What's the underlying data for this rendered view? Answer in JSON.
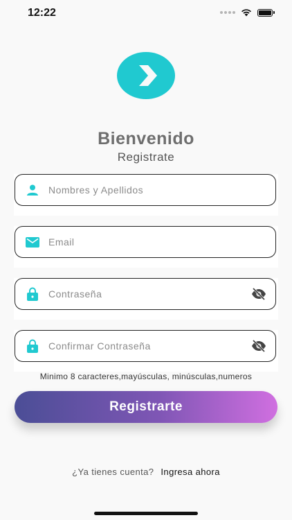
{
  "status_bar": {
    "time": "12:22"
  },
  "header": {
    "title": "Bienvenido",
    "subtitle": "Registrate"
  },
  "form": {
    "fields": [
      {
        "icon": "user-icon",
        "placeholder": "Nombres y Apellidos"
      },
      {
        "icon": "mail-icon",
        "placeholder": "Email"
      },
      {
        "icon": "lock-icon",
        "placeholder": "Contraseña",
        "trailing_icon": "eye-off-icon"
      },
      {
        "icon": "lock-icon",
        "placeholder": "Confirmar Contraseña",
        "trailing_icon": "eye-off-icon"
      }
    ],
    "password_hint": "Minimo 8 caracteres,mayúsculas, minúsculas,numeros",
    "submit_label": "Registrarte"
  },
  "footer": {
    "question": "¿Ya tienes cuenta?",
    "login_link": "Ingresa ahora"
  },
  "colors": {
    "accent": "#20c9d0",
    "button_gradient_start": "#4b4e96",
    "button_gradient_end": "#d06fe0"
  }
}
